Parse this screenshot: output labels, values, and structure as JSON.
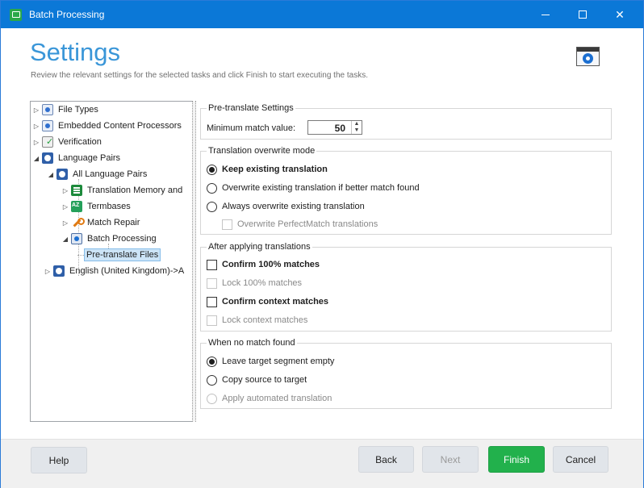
{
  "window": {
    "title": "Batch Processing"
  },
  "header": {
    "title": "Settings",
    "subtitle": "Review the relevant settings for the selected tasks and click Finish to start executing the tasks."
  },
  "tree": {
    "items": [
      {
        "label": "File Types",
        "icon": "document-settings-icon"
      },
      {
        "label": "Embedded Content Processors",
        "icon": "document-settings-icon"
      },
      {
        "label": "Verification",
        "icon": "verification-check-icon"
      },
      {
        "label": "Language Pairs",
        "icon": "language-pair-icon"
      },
      {
        "label": "All Language Pairs",
        "icon": "language-pair-icon"
      },
      {
        "label": "Translation Memory and",
        "icon": "translation-memory-icon"
      },
      {
        "label": "Termbases",
        "icon": "termbase-icon"
      },
      {
        "label": "Match Repair",
        "icon": "wrench-icon"
      },
      {
        "label": "Batch Processing",
        "icon": "batch-processing-icon"
      },
      {
        "label": "Pre-translate Files",
        "icon": ""
      },
      {
        "label": "English (United Kingdom)->A",
        "icon": "language-pair-icon"
      }
    ]
  },
  "pretranslate": {
    "group_title": "Pre-translate Settings",
    "min_match_label": "Minimum match value:",
    "min_match_value": "50"
  },
  "overwrite": {
    "group_title": "Translation overwrite mode",
    "keep": "Keep existing translation",
    "overwrite_better": "Overwrite existing translation if better match found",
    "always": "Always overwrite existing translation",
    "perfectmatch": "Overwrite PerfectMatch translations"
  },
  "after": {
    "group_title": "After applying translations",
    "confirm100": "Confirm 100% matches",
    "lock100": "Lock 100% matches",
    "confirm_context": "Confirm context matches",
    "lock_context": "Lock context matches"
  },
  "nomatch": {
    "group_title": "When no match found",
    "leave_empty": "Leave target segment empty",
    "copy_source": "Copy source to target",
    "apply_auto": "Apply automated translation"
  },
  "footer": {
    "help": "Help",
    "back": "Back",
    "next": "Next",
    "finish": "Finish",
    "cancel": "Cancel"
  },
  "colors": {
    "titlebar": "#0b78d7",
    "accent_title": "#3a96d8",
    "finish_button": "#22b14c"
  }
}
